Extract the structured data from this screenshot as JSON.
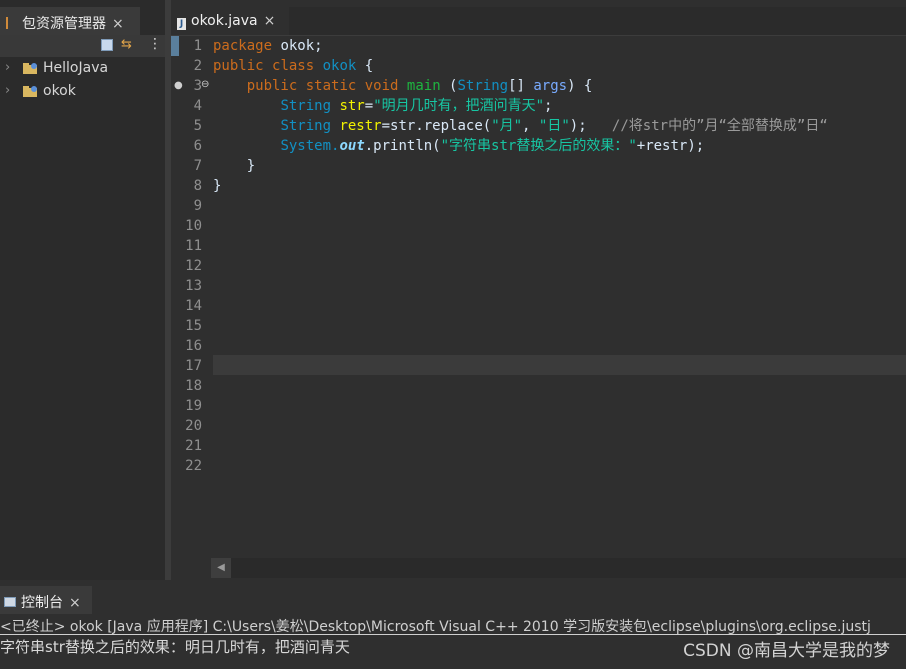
{
  "package_explorer": {
    "tab_label": "包资源管理器",
    "close_label": "×",
    "projects": [
      {
        "name": "HelloJava",
        "chevron": "›"
      },
      {
        "name": "okok",
        "chevron": "›"
      }
    ]
  },
  "editor": {
    "tab_label": "okok.java",
    "close_label": "×",
    "line_numbers": [
      "1",
      "2",
      "3",
      "4",
      "5",
      "6",
      "7",
      "8",
      "9",
      "10",
      "11",
      "12",
      "13",
      "14",
      "15",
      "16",
      "17",
      "18",
      "19",
      "20",
      "21",
      "22"
    ],
    "code": {
      "l1_kw": "package",
      "l1_rest": " okok;",
      "l2_kw1": "public",
      "l2_kw2": "class",
      "l2_cls": "okok",
      "l2_rest": " {",
      "l3_kw1": "public",
      "l3_kw2": "static",
      "l3_kw3": "void",
      "l3_m": "main",
      "l3_ty": "String",
      "l3_rest": "[] ",
      "l3_arg": "args",
      "l3_end": ") {",
      "l4_ty": "String",
      "l4_var": "str",
      "l4_str": "\"明月几时有，把酒问青天\"",
      "l5_ty": "String",
      "l5_var": "restr",
      "l5_mid": "=str.replace(",
      "l5_s1": "\"月\"",
      "l5_comma": ", ",
      "l5_s2": "\"日\"",
      "l5_end": ");",
      "l5_comment": "//将str中的”月“全部替换成”日“",
      "l6_sys": "System.",
      "l6_out": "out",
      "l6_mid": ".println(",
      "l6_str": "\"字符串str替换之后的效果：\"",
      "l6_end": "+restr);",
      "l7": "    }",
      "l8": "}"
    }
  },
  "console": {
    "tab_label": "控制台",
    "close_label": "×",
    "header": "<已终止> okok [Java 应用程序] C:\\Users\\姜松\\Desktop\\Microsoft Visual C++ 2010 学习版安装包\\eclipse\\plugins\\org.eclipse.justj",
    "output": "字符串str替换之后的效果：明日几时有，把酒问青天",
    "watermark": "CSDN @南昌大学是我的梦"
  },
  "colors": {
    "keyword": "#cc6c1d",
    "type": "#1290c3",
    "string": "#17c6a3",
    "comment": "#9a9a9a",
    "background": "#2f2f2f"
  },
  "icons": [
    "package-explorer-icon",
    "collapse-all-icon",
    "link-editor-icon",
    "view-menu-icon",
    "java-project-icon",
    "java-file-icon",
    "console-icon",
    "breakpoint-marker-icon",
    "fold-icon",
    "scroll-left-icon"
  ]
}
